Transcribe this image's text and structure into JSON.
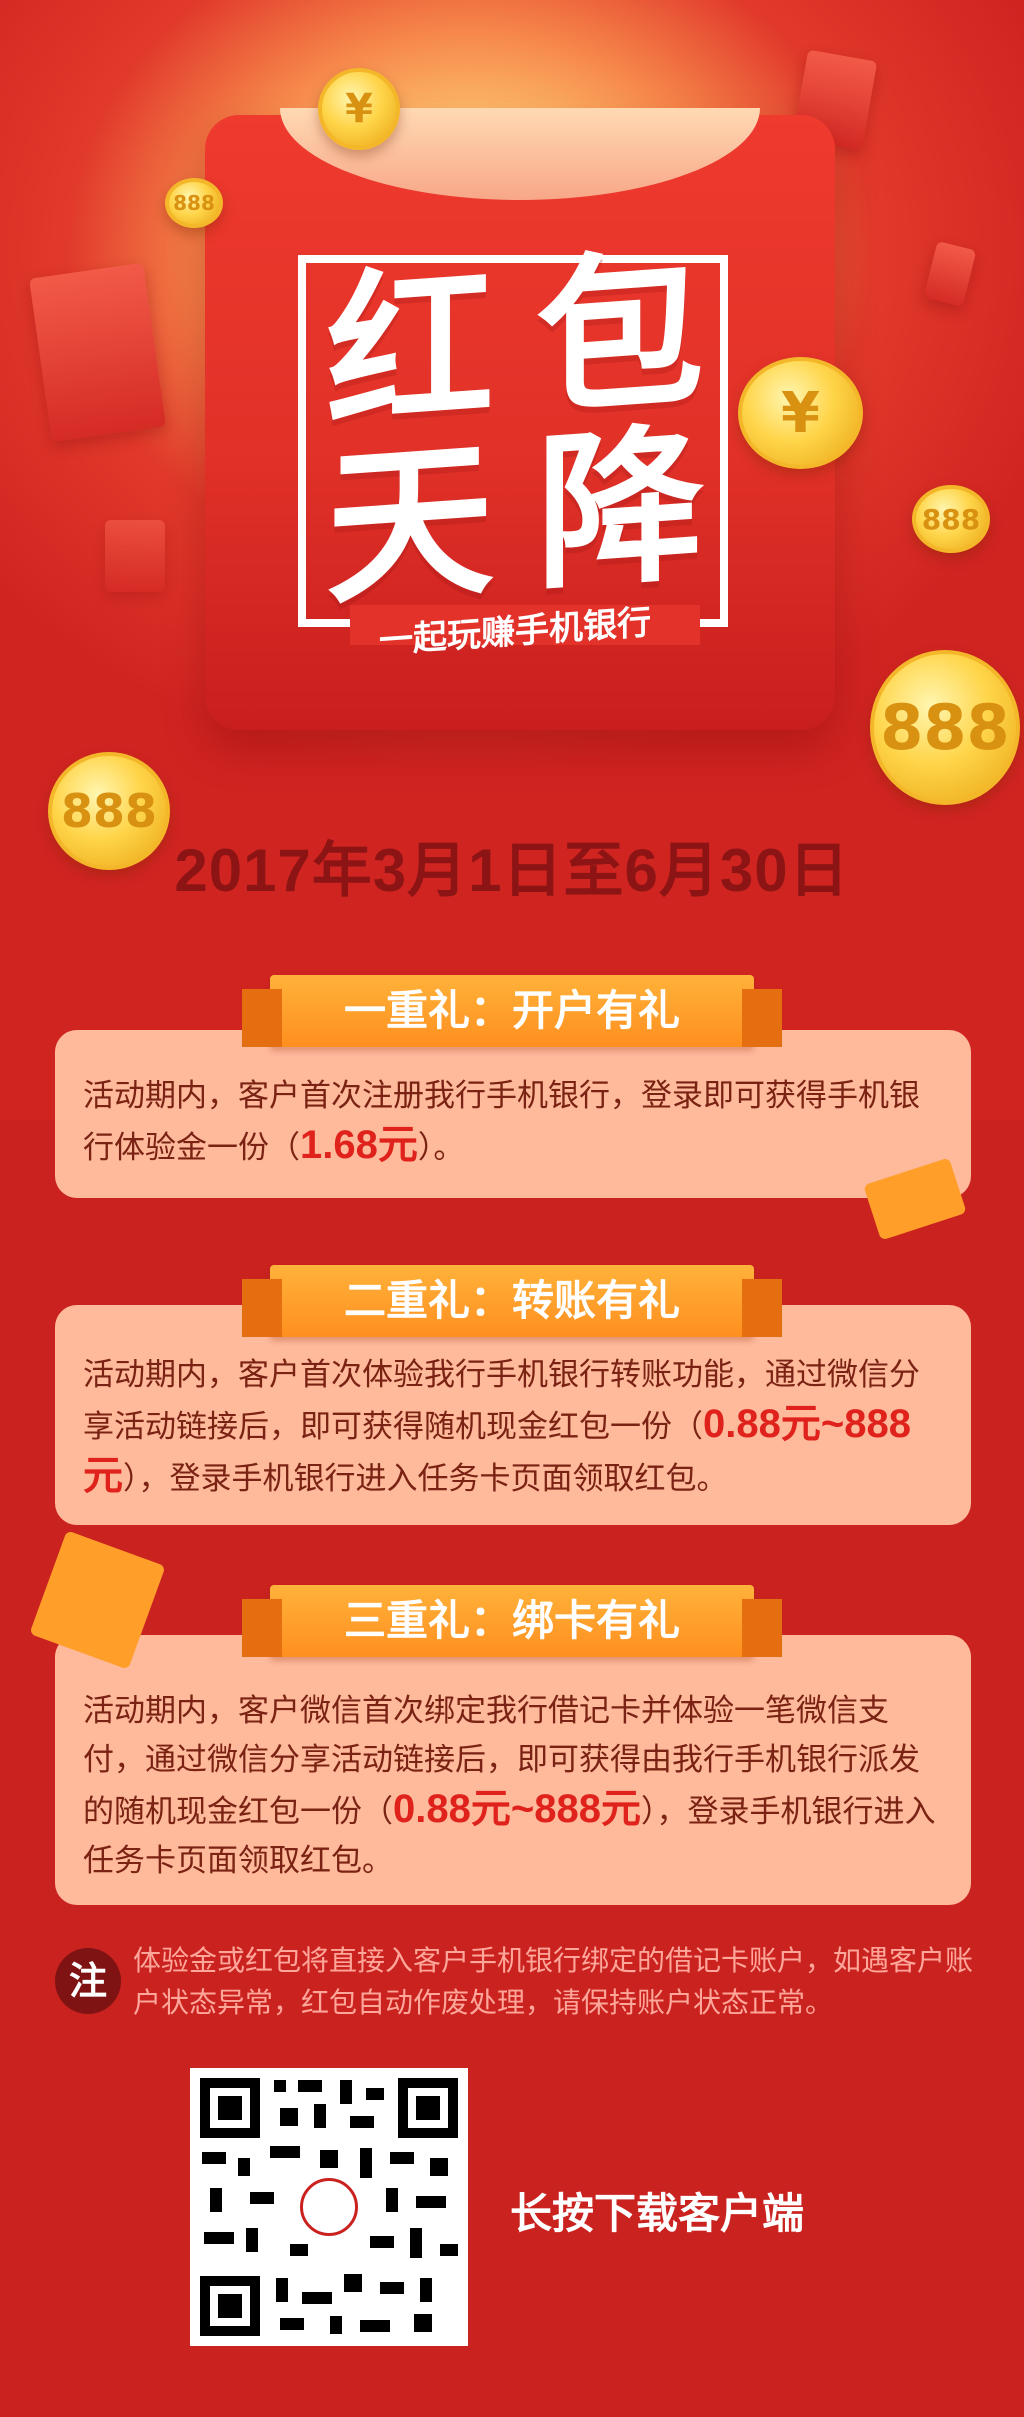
{
  "hero": {
    "title_chars": [
      "红",
      "包",
      "天",
      "降"
    ],
    "subtitle": "一起玩赚手机银行",
    "coin_yuan": "¥",
    "coin_888": "888"
  },
  "date_range": "2017年3月1日至6月30日",
  "gifts": [
    {
      "title": "一重礼：开户有礼",
      "text_before": "活动期内，客户首次注册我行手机银行，登录即可获得手机银行体验金一份（",
      "highlight": "1.68元",
      "text_after": "）。"
    },
    {
      "title": "二重礼：转账有礼",
      "text_before": "活动期内，客户首次体验我行手机银行转账功能，通过微信分享活动链接后，即可获得随机现金红包一份（",
      "highlight": "0.88元~888元",
      "text_after": "），登录手机银行进入任务卡页面领取红包。"
    },
    {
      "title": "三重礼：绑卡有礼",
      "text_before": "活动期内，客户微信首次绑定我行借记卡并体验一笔微信支付，通过微信分享活动链接后，即可获得由我行手机银行派发的随机现金红包一份（",
      "highlight": "0.88元~888元",
      "text_after": "），登录手机银行进入任务卡页面领取红包。"
    }
  ],
  "note": {
    "badge": "注",
    "text": "体验金或红包将直接入客户手机银行绑定的借记卡账户，如遇客户账户状态异常，红包自动作废处理，请保持账户状态正常。"
  },
  "download": {
    "cta": "长按下载客户端"
  },
  "colors": {
    "primary_red": "#c9221f",
    "highlight_red": "#e0221c",
    "banner_orange": "#ff9a26",
    "card_pink": "#ffb99b",
    "coin_gold": "#ffd54a"
  }
}
